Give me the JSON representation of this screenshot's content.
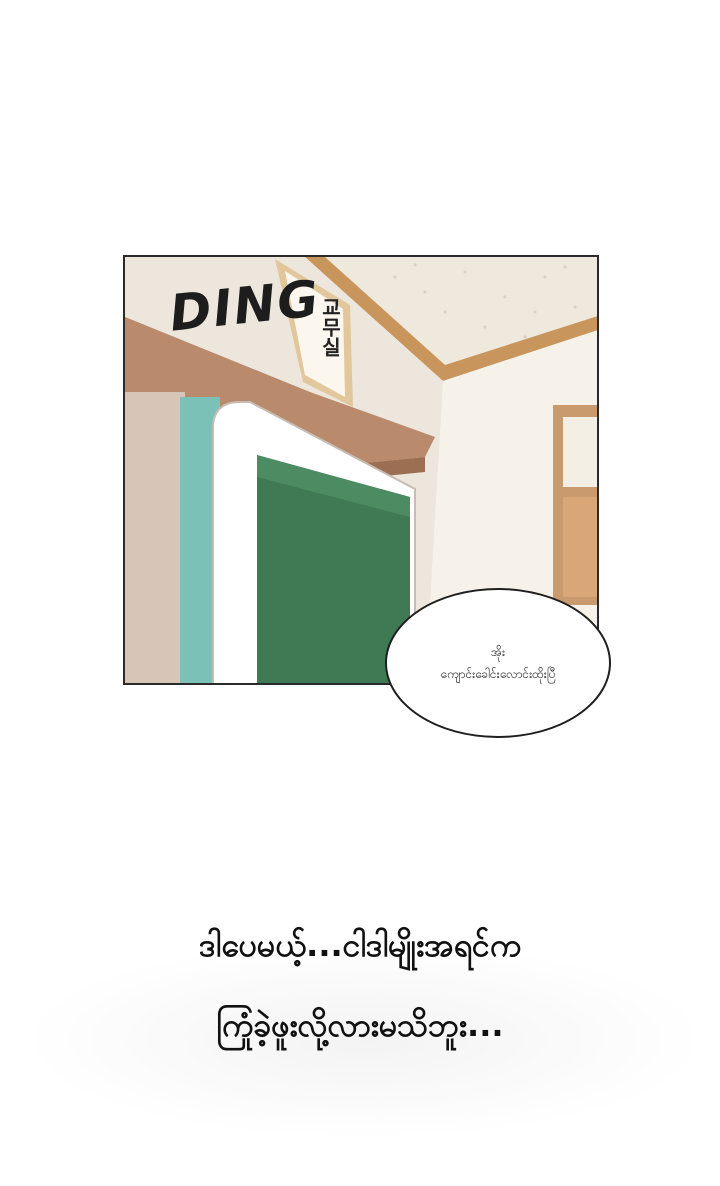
{
  "panel": {
    "sfx": "DING",
    "plaque": "교무실",
    "colors": {
      "wall": "#f3efe8",
      "ceiling_trim": "#c8955c",
      "door_frame": "#ffffff",
      "board": "#3f7a55",
      "left_strip": "#7bc1b8",
      "wood": "#b98a6b"
    }
  },
  "bubble": {
    "line1": "အိုး",
    "line2": "ကျောင်းခေါင်းလောင်းထိုးပြီ"
  },
  "narration": {
    "line1": "ဒါပေမယ့်...ငါဒါမျိုးအရင်က",
    "line2": "ကြုံခဲ့ဖူးလို့လားမသိဘူး..."
  }
}
